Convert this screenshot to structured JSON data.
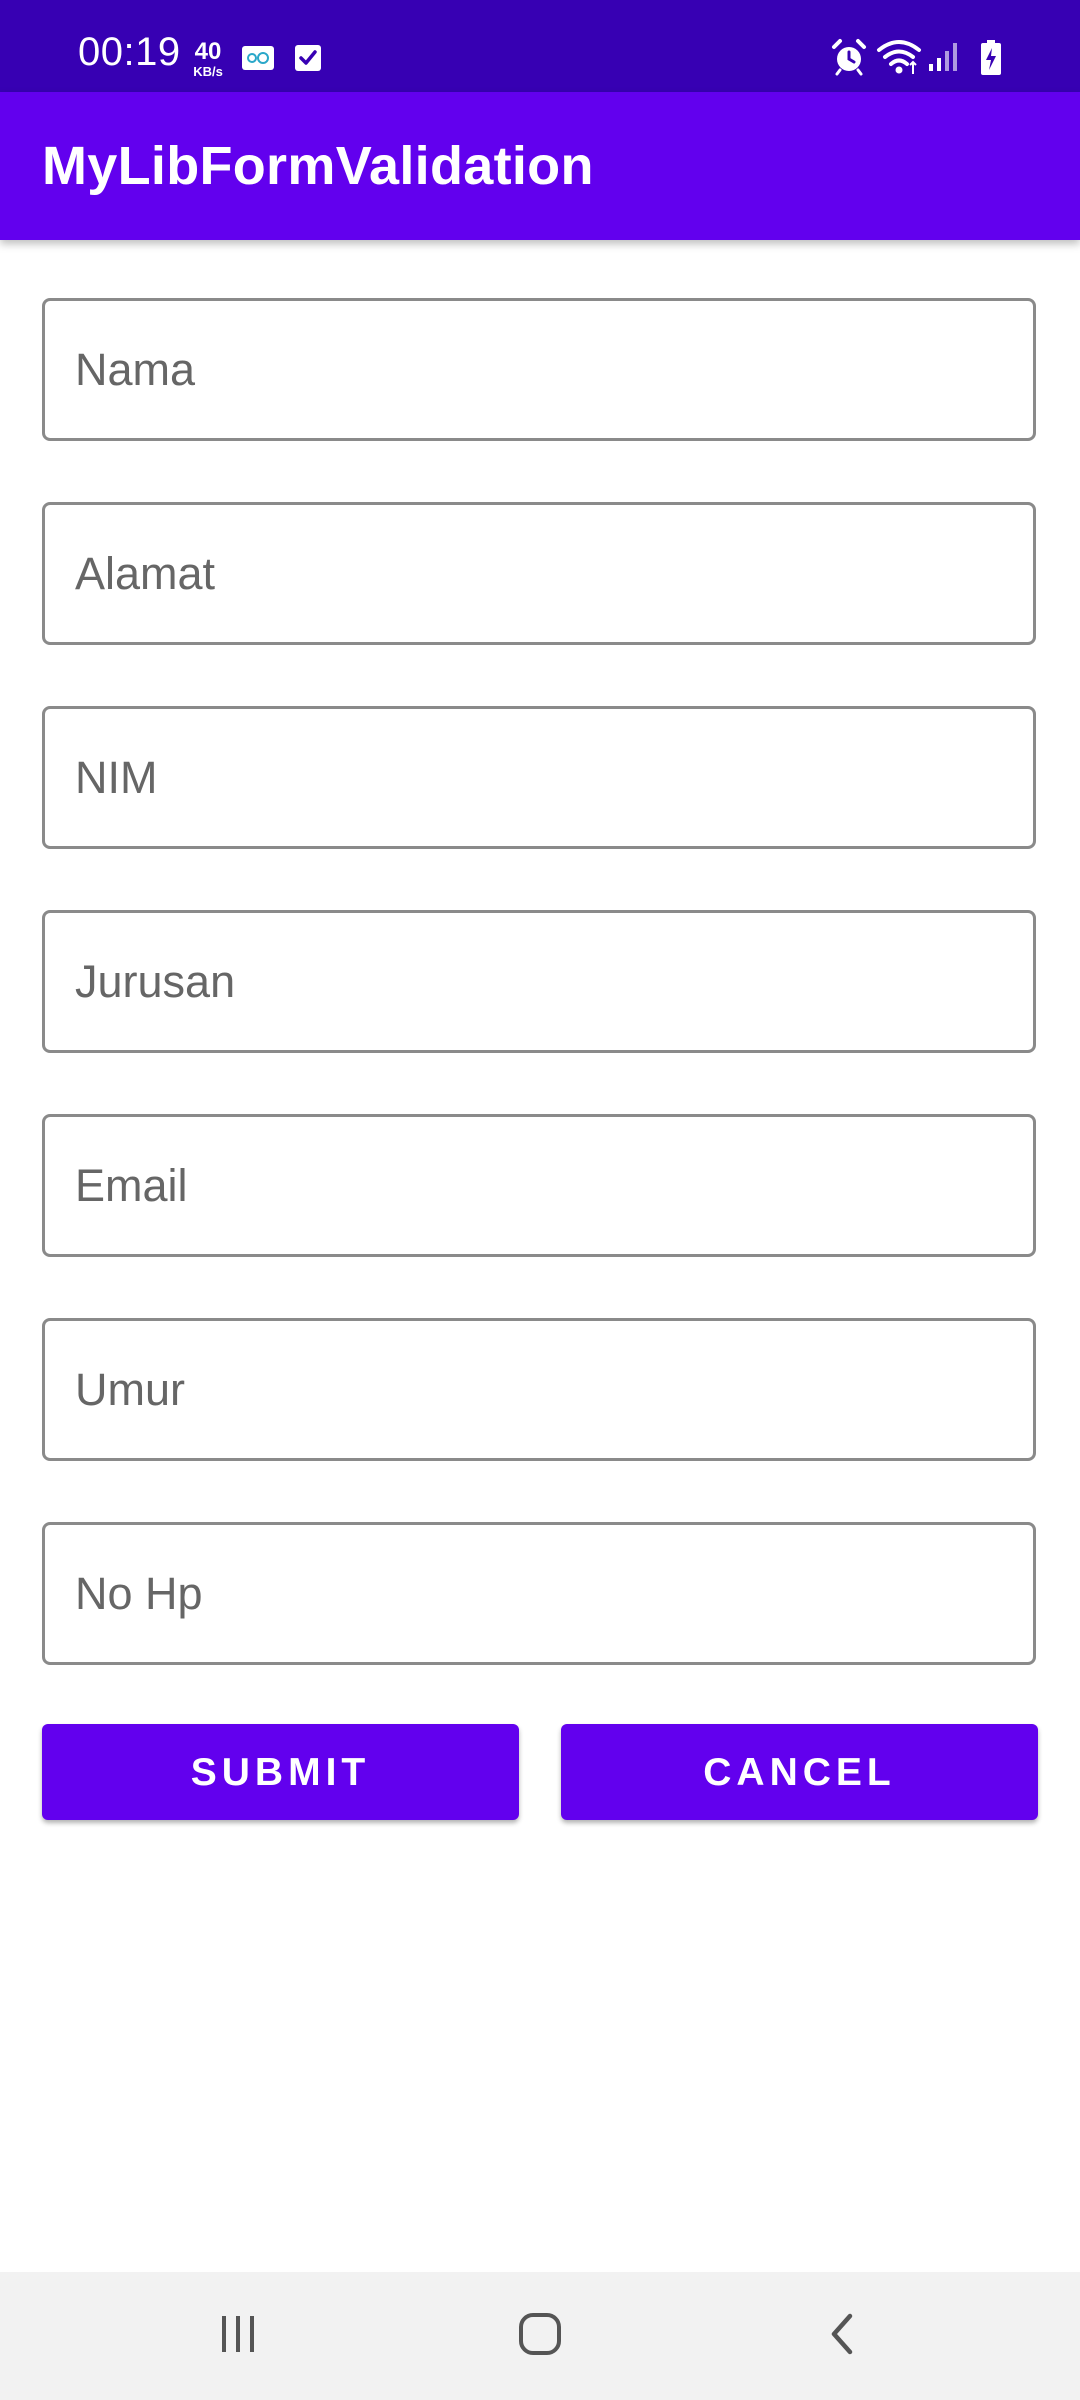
{
  "status_bar": {
    "time": "00:19",
    "net_speed_value": "40",
    "net_speed_unit": "KB/s",
    "icons": [
      "kazoo-notification-icon",
      "task-check-icon",
      "alarm-icon",
      "wifi-icon",
      "signal-icon",
      "battery-charging-icon"
    ],
    "background_color": "#3700b3"
  },
  "app_bar": {
    "title": "MyLibFormValidation",
    "background_color": "#6200ee"
  },
  "form": {
    "fields": [
      {
        "placeholder": "Nama",
        "value": ""
      },
      {
        "placeholder": "Alamat",
        "value": ""
      },
      {
        "placeholder": "NIM",
        "value": ""
      },
      {
        "placeholder": "Jurusan",
        "value": ""
      },
      {
        "placeholder": "Email",
        "value": ""
      },
      {
        "placeholder": "Umur",
        "value": ""
      },
      {
        "placeholder": "No Hp",
        "value": ""
      }
    ],
    "submit_label": "SUBMIT",
    "cancel_label": "CANCEL",
    "button_color": "#6200ee"
  },
  "nav_bar": {
    "icons": [
      "recents-icon",
      "home-icon",
      "back-icon"
    ]
  }
}
